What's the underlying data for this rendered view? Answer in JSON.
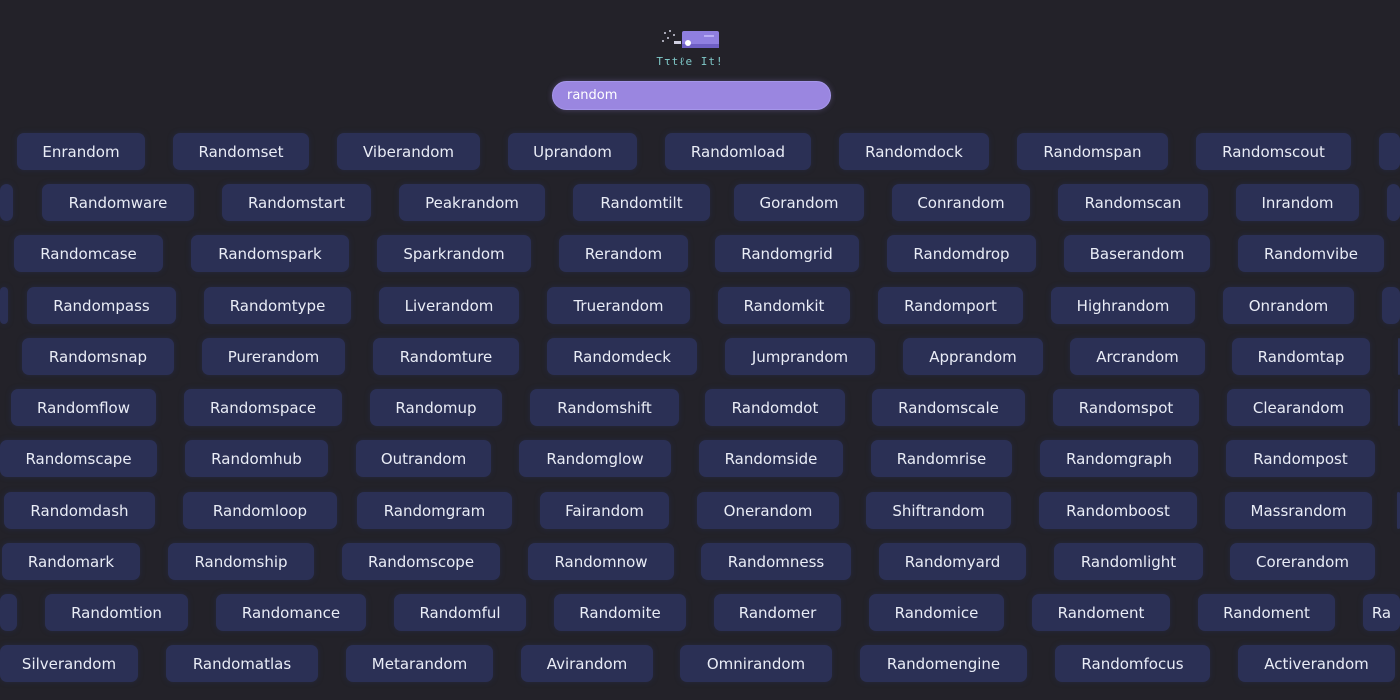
{
  "header": {
    "logo_title": "Tτtℓe Itǃ",
    "search_value": "random"
  },
  "rows": [
    {
      "offset": 0,
      "items": [
        "Enrandom",
        "Randomset",
        "Viberandom",
        "Uprandom",
        "Randomload",
        "Randomdock",
        "Randomspan",
        "Randomscout"
      ]
    },
    {
      "offset": 0,
      "items": [
        "Randomware",
        "Randomstart",
        "Peakrandom",
        "Randomtilt",
        "Gorandom",
        "Conrandom",
        "Randomscan",
        "Inrandom"
      ]
    },
    {
      "offset": 0,
      "items": [
        "Randomcase",
        "Randomspark",
        "Sparkrandom",
        "Rerandom",
        "Randomgrid",
        "Randomdrop",
        "Baserandom",
        "Randomvibe"
      ]
    },
    {
      "offset": 0,
      "items": [
        "Randompass",
        "Randomtype",
        "Liverandom",
        "Truerandom",
        "Randomkit",
        "Randomport",
        "Highrandom",
        "Onrandom"
      ]
    },
    {
      "offset": 0,
      "items": [
        "Randomsnap",
        "Purerandom",
        "Randomture",
        "Randomdeck",
        "Jumprandom",
        "Apprandom",
        "Arcrandom",
        "Randomtap"
      ]
    },
    {
      "offset": 0,
      "items": [
        "Randomflow",
        "Randomspace",
        "Randomup",
        "Randomshift",
        "Randomdot",
        "Randomscale",
        "Randomspot",
        "Clearandom"
      ]
    },
    {
      "offset": 0,
      "items": [
        "Randomscape",
        "Randomhub",
        "Outrandom",
        "Randomglow",
        "Randomside",
        "Randomrise",
        "Randomgraph",
        "Randompost"
      ]
    },
    {
      "offset": 0,
      "items": [
        "Randomdash",
        "Randomloop",
        "Randomgram",
        "Fairandom",
        "Onerandom",
        "Shiftrandom",
        "Randomboost",
        "Massrandom"
      ]
    },
    {
      "offset": 0,
      "items": [
        "Randomark",
        "Randomship",
        "Randomscope",
        "Randomnow",
        "Randomness",
        "Randomyard",
        "Randomlight",
        "Corerandom"
      ]
    },
    {
      "offset": 0,
      "items": [
        "Randomtion",
        "Randomance",
        "Randomful",
        "Randomite",
        "Randomer",
        "Randomice",
        "Randoment",
        "Randoment",
        "Ra"
      ]
    },
    {
      "offset": 0,
      "items": [
        "Silverandom",
        "Randomatlas",
        "Metarandom",
        "Avirandom",
        "Omnirandom",
        "Randomengine",
        "Randomfocus",
        "Activerandom"
      ]
    }
  ]
}
